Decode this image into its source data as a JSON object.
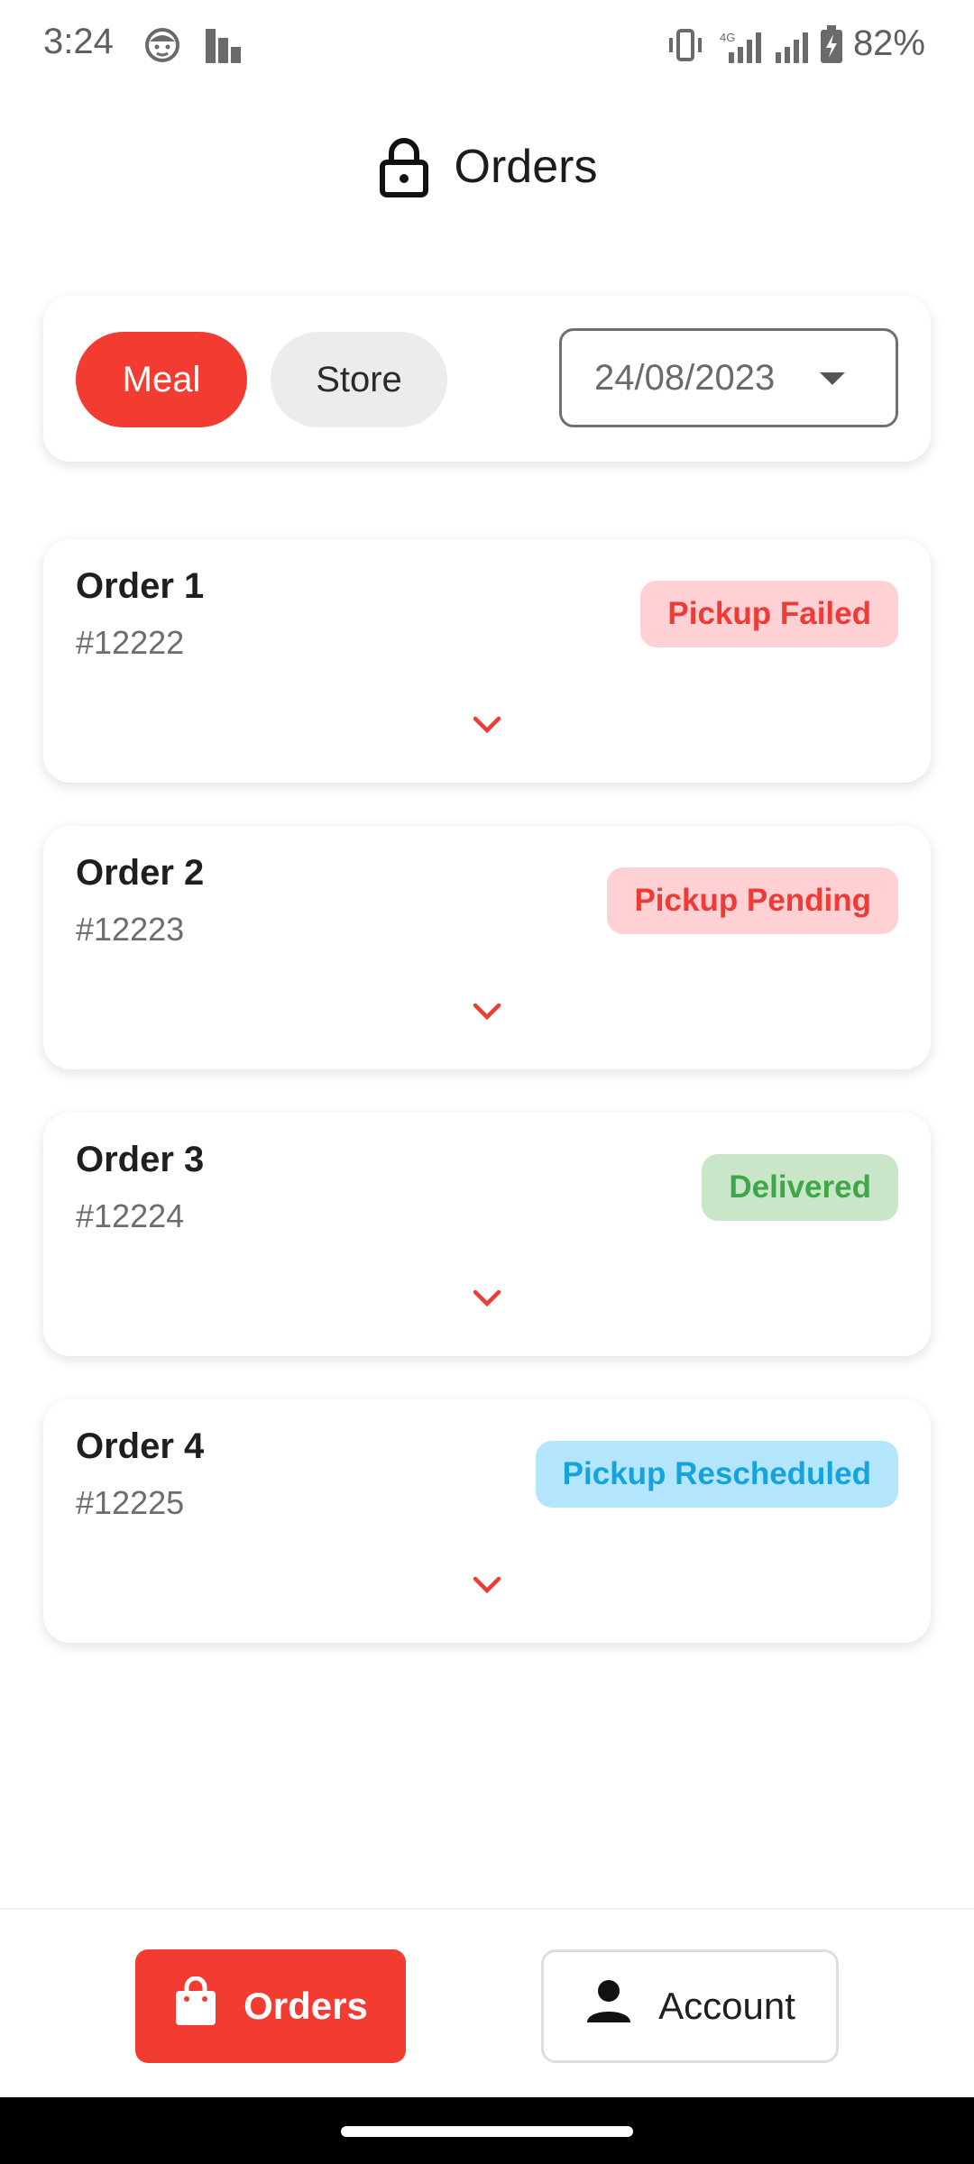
{
  "status_bar": {
    "time": "3:24",
    "network_label": "4G",
    "battery": "82%"
  },
  "header": {
    "title": "Orders",
    "icon": "lock-icon"
  },
  "filters": {
    "tabs": [
      {
        "label": "Meal",
        "selected": true
      },
      {
        "label": "Store",
        "selected": false
      }
    ],
    "date": "24/08/2023"
  },
  "orders": [
    {
      "title": "Order 1",
      "number": "#12222",
      "status": "Pickup Failed",
      "status_bg": "#ffd0d4",
      "status_color": "#ee3b36"
    },
    {
      "title": "Order 2",
      "number": "#12223",
      "status": "Pickup Pending",
      "status_bg": "#ffd0d4",
      "status_color": "#ee3b36"
    },
    {
      "title": "Order 3",
      "number": "#12224",
      "status": "Delivered",
      "status_bg": "#c9e7c8",
      "status_color": "#3fa749"
    },
    {
      "title": "Order 4",
      "number": "#12225",
      "status": "Pickup Rescheduled",
      "status_bg": "#b3e5fc",
      "status_color": "#15a3dd"
    }
  ],
  "bottom_nav": {
    "orders_label": "Orders",
    "account_label": "Account"
  },
  "colors": {
    "accent": "#f23c32",
    "chip_inactive": "#ececec"
  }
}
